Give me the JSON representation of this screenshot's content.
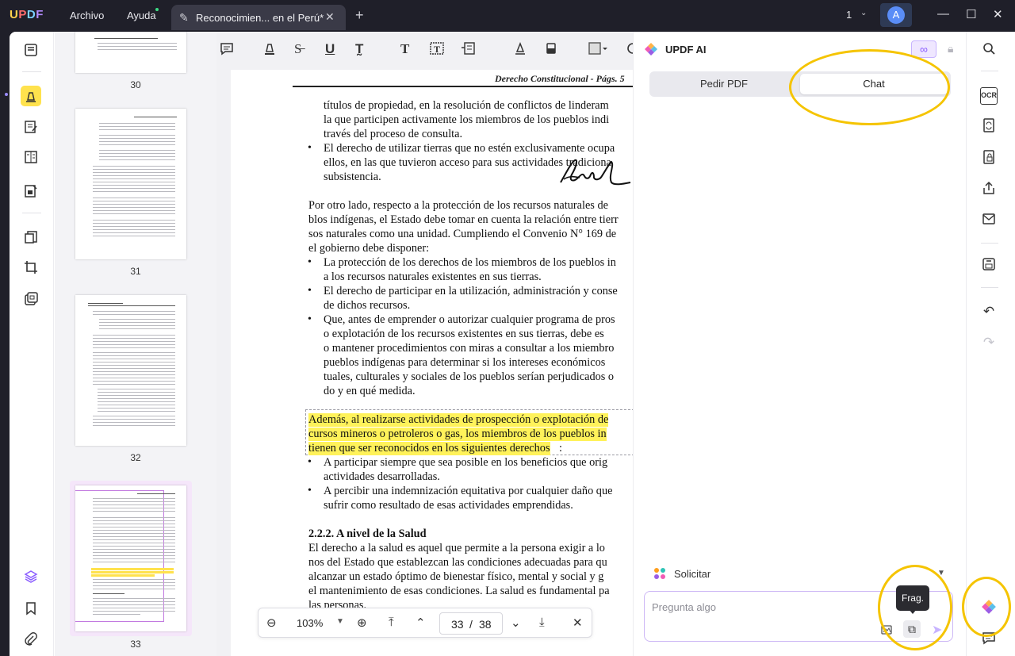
{
  "app": {
    "logo": "UPDF",
    "menu": {
      "file": "Archivo",
      "help": "Ayuda"
    },
    "tab_title": "Reconocimien... en el Perú*",
    "window_count": "1",
    "avatar_letter": "A"
  },
  "icons": {
    "doc_tab": "edit-pencil-icon",
    "left_tools": [
      "reader-icon",
      "comment-highlighter-icon",
      "edit-text-icon",
      "form-icon",
      "organize-icon",
      "page-tools-icon",
      "crop-icon",
      "ocr-stack-icon",
      "layers-icon",
      "bookmark-icon",
      "attachment-icon"
    ],
    "right_tools": [
      "search-icon",
      "ocr-icon",
      "convert-icon",
      "protect-icon",
      "share-icon",
      "mail-icon",
      "save-icon",
      "undo-icon",
      "redo-icon",
      "updf-ai-icon",
      "comment-list-icon"
    ]
  },
  "colors": {
    "highlight": "#fff25a",
    "annotation": "#f5c400",
    "accent": "#8a5cff",
    "active_tool": "#ffe24d"
  },
  "thumbnails": [
    {
      "label": "30"
    },
    {
      "label": "31"
    },
    {
      "label": "32"
    },
    {
      "label": "33",
      "selected": true
    }
  ],
  "document": {
    "header": "Derecho Constitucional - Págs. 5",
    "lines": [
      "títulos de propiedad, en la resolución de conflictos de linderam",
      "la que participen activamente los miembros de los pueblos indi",
      "través del proceso de consulta.",
      "El derecho de utilizar tierras que no estén exclusivamente ocupa",
      "ellos, en las que tuvieron acceso para sus actividades tradiciona",
      "subsistencia.",
      "Por otro lado, respecto a la protección de los recursos naturales de",
      "blos indígenas, el Estado debe tomar en cuenta la relación entre tierr",
      "sos naturales como una unidad. Cumpliendo el Convenio N° 169 de",
      "el gobierno debe disponer:",
      "La protección de los derechos de los miembros de los pueblos in",
      "a los recursos naturales existentes en sus tierras.",
      "El derecho de participar en la utilización, administración y conse",
      "de dichos recursos.",
      "Que, antes de emprender o autorizar cualquier programa de pros",
      "o explotación de los recursos existentes en sus tierras, debe es",
      "o mantener procedimientos con miras a consultar a los miembro",
      "pueblos indígenas para determinar si los intereses económicos",
      "tuales, culturales y sociales de los pueblos serían perjudicados o",
      "do y en qué medida.",
      "Además, al realizarse actividades de prospección o explotación de",
      "cursos mineros o petroleros o gas, los miembros de los pueblos in",
      "tienen que ser reconocidos en los siguientes derechos",
      ":",
      "A participar siempre que sea posible en los beneficios que orig",
      "actividades desarrolladas.",
      "A percibir una indemnización equitativa por cualquier daño que",
      "sufrir como resultado de esas actividades emprendidas.",
      "2.2.2. A nivel de la Salud",
      "El derecho a la salud es aquel que permite a la persona exigir a lo",
      "nos del Estado que establezcan las condiciones adecuadas para qu",
      "alcanzar un estado óptimo de bienestar físico, mental y social y g",
      "el mantenimiento de esas condiciones. La salud es fundamental pa",
      "las personas."
    ]
  },
  "zoombar": {
    "zoom": "103%",
    "current_page": "33",
    "separator": "/",
    "total_pages": "38"
  },
  "ai": {
    "title": "UPDF AI",
    "infinite": "∞",
    "tabs": {
      "ask_pdf": "Pedir PDF",
      "chat": "Chat"
    },
    "prompt_mode": "Solicitar",
    "input_placeholder": "Pregunta algo",
    "tooltip": "Frag."
  }
}
